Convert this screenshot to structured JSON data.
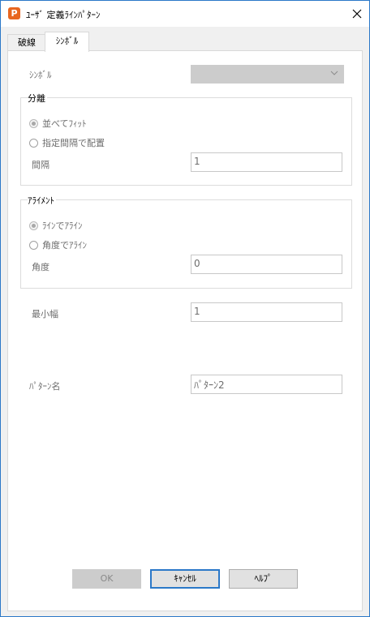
{
  "window": {
    "title": "ﾕｰｻﾞ 定義ﾗｲﾝﾊﾟﾀｰﾝ",
    "app_icon_letter": "P"
  },
  "tabs": [
    {
      "label": "破線",
      "active": false
    },
    {
      "label": "ｼﾝﾎﾞﾙ",
      "active": true
    }
  ],
  "symbol": {
    "label": "ｼﾝﾎﾞﾙ",
    "value": ""
  },
  "separation": {
    "title": "分離",
    "options": [
      {
        "label": "並べてﾌｨｯﾄ",
        "selected": true
      },
      {
        "label": "指定間隔で配置",
        "selected": false
      }
    ],
    "interval_label": "間隔",
    "interval_value": "1"
  },
  "alignment": {
    "title": "ｱﾗｲﾒﾝﾄ",
    "options": [
      {
        "label": "ﾗｲﾝでｱﾗｲﾝ",
        "selected": true
      },
      {
        "label": "角度でｱﾗｲﾝ",
        "selected": false
      }
    ],
    "angle_label": "角度",
    "angle_value": "0"
  },
  "min_width": {
    "label": "最小幅",
    "value": "1"
  },
  "pattern_name": {
    "label": "ﾊﾟﾀｰﾝ名",
    "value": "ﾊﾟﾀｰﾝ2"
  },
  "buttons": {
    "ok": "OK",
    "cancel": "ｷｬﾝｾﾙ",
    "help": "ﾍﾙﾌﾟ"
  },
  "colors": {
    "accent": "#2b78c8",
    "app_icon": "#e8661f",
    "disabled": "#cccccc"
  }
}
